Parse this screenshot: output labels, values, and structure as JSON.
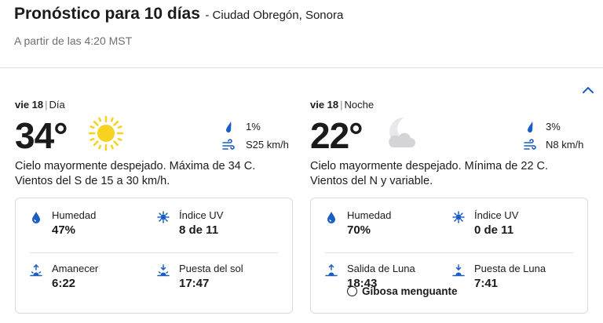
{
  "header": {
    "title": "Pronóstico para 10 días",
    "location": "- Ciudad Obregón, Sonora",
    "as_of": "A partir de las 4:20 MST"
  },
  "day": {
    "date": "vie 18",
    "separator": "|",
    "period": "Día",
    "temp": "34°",
    "icon": "sun-icon",
    "precip": "1%",
    "wind": "S25 km/h",
    "description": "Cielo mayormente despejado. Máxima de 34 C. Vientos del S de 15 a 30 km/h.",
    "details": {
      "humidity_label": "Humedad",
      "humidity_value": "47%",
      "uv_label": "Índice UV",
      "uv_value": "8 de 11",
      "sunrise_label": "Amanecer",
      "sunrise_value": "6:22",
      "sunset_label": "Puesta del sol",
      "sunset_value": "17:47"
    }
  },
  "night": {
    "date": "vie 18",
    "separator": "|",
    "period": "Noche",
    "temp": "22°",
    "icon": "moon-cloud-icon",
    "precip": "3%",
    "wind": "N8 km/h",
    "description": "Cielo mayormente despejado. Mínima de 22 C. Vientos del N y variable.",
    "details": {
      "humidity_label": "Humedad",
      "humidity_value": "70%",
      "uv_label": "Índice UV",
      "uv_value": "0 de 11",
      "moonrise_label": "Salida de Luna",
      "moonrise_value": "18:43",
      "moonset_label": "Puesta de Luna",
      "moonset_value": "7:41",
      "moon_phase": "Gibosa menguante"
    }
  },
  "colors": {
    "accent": "#1a5ec4",
    "sun": "#f7d21f",
    "text": "#1b1b1b",
    "muted": "#6f6f6f"
  }
}
